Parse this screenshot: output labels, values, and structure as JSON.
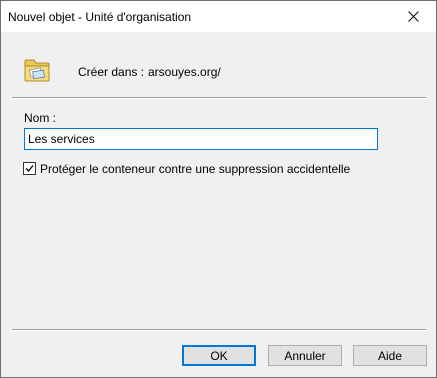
{
  "window": {
    "title": "Nouvel objet - Unité d'organisation"
  },
  "header": {
    "icon": "folder-ou-icon",
    "create_in_label": "Créer dans :",
    "create_in_path": "arsouyes.org/"
  },
  "form": {
    "name_label": "Nom :",
    "name_value": "Les services",
    "protect_checkbox": {
      "label": "Protéger le conteneur contre une suppression accidentelle",
      "checked": true
    }
  },
  "buttons": {
    "ok": "OK",
    "cancel": "Annuler",
    "help": "Aide"
  },
  "colors": {
    "accent": "#0078d7",
    "dialog_bg": "#f0f0f0",
    "titlebar_bg": "#ffffff",
    "button_bg": "#e1e1e1"
  }
}
